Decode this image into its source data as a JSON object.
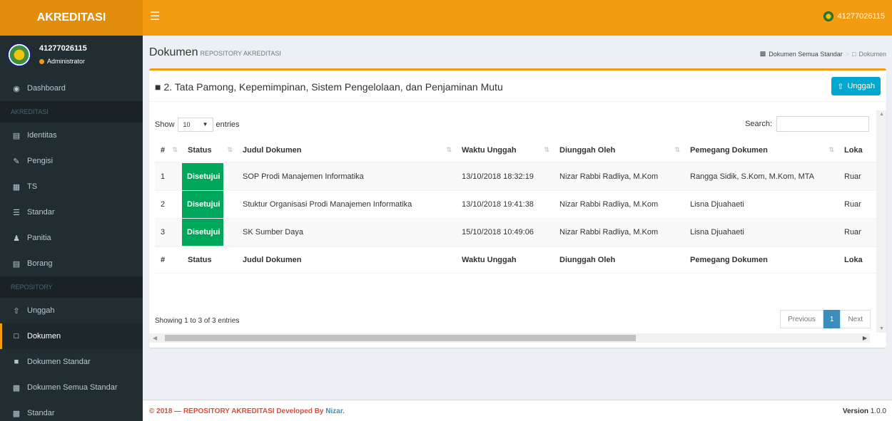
{
  "app": {
    "logo": "AKREDITASI",
    "brand_color": "#f39c12",
    "user_id": "41277026115"
  },
  "sidebar": {
    "user": {
      "name": "41277026115",
      "role": "Administrator"
    },
    "dashboard": {
      "label": "Dashboard",
      "icon": "dashboard-icon"
    },
    "section1": "AKREDITASI",
    "items1": [
      {
        "label": "Identitas",
        "icon": "bank-icon"
      },
      {
        "label": "Pengisi",
        "icon": "pencil-icon"
      },
      {
        "label": "TS",
        "icon": "calendar-icon"
      },
      {
        "label": "Standar",
        "icon": "list-icon"
      },
      {
        "label": "Panitia",
        "icon": "user-icon"
      },
      {
        "label": "Borang",
        "icon": "file-text-icon"
      }
    ],
    "section2": "REPOSITORY",
    "items2": [
      {
        "label": "Unggah",
        "icon": "upload-icon"
      },
      {
        "label": "Dokumen",
        "icon": "file-icon",
        "active": true
      },
      {
        "label": "Dokumen Standar",
        "icon": "file-solid-icon"
      },
      {
        "label": "Dokumen Semua Standar",
        "icon": "archive-icon"
      },
      {
        "label": "Standar",
        "icon": "archive-icon"
      }
    ]
  },
  "header": {
    "title": "Dokumen",
    "subtitle": "REPOSITORY AKREDITASI",
    "breadcrumb": [
      "Dokumen Semua Standar",
      "Dokumen"
    ]
  },
  "box": {
    "title": "2. Tata Pamong, Kepemimpinan, Sistem Pengelolaan, dan Penjaminan Mutu",
    "upload_label": "Unggah"
  },
  "table_controls": {
    "show_label": "Show",
    "page_size": "10",
    "entries_label": "entries",
    "search_label": "Search:"
  },
  "table": {
    "columns": [
      "#",
      "Status",
      "Judul Dokumen",
      "Waktu Unggah",
      "Diunggah Oleh",
      "Pemegang Dokumen",
      "Loka"
    ],
    "rows": [
      {
        "no": "1",
        "status": "Disetujui",
        "judul": "SOP Prodi Manajemen Informatika",
        "waktu": "13/10/2018 18:32:19",
        "oleh": "Nizar Rabbi Radliya, M.Kom",
        "pemegang": "Rangga Sidik, S.Kom, M.Kom, MTA",
        "lokasi": "Ruar"
      },
      {
        "no": "2",
        "status": "Disetujui",
        "judul": "Stuktur Organisasi Prodi Manajemen Informatika",
        "waktu": "13/10/2018 19:41:38",
        "oleh": "Nizar Rabbi Radliya, M.Kom",
        "pemegang": "Lisna Djuahaeti",
        "lokasi": "Ruar"
      },
      {
        "no": "3",
        "status": "Disetujui",
        "judul": "SK Sumber Daya",
        "waktu": "15/10/2018 10:49:06",
        "oleh": "Nizar Rabbi Radliya, M.Kom",
        "pemegang": "Lisna Djuahaeti",
        "lokasi": "Ruar"
      }
    ],
    "info": "Showing 1 to 3 of 3 entries",
    "pager": {
      "prev": "Previous",
      "current": "1",
      "next": "Next"
    }
  },
  "footer": {
    "left": "© 2018 — REPOSITORY AKREDITASI Developed By",
    "author": "Nizar",
    "version_label": "Version",
    "version": "1.0.0"
  }
}
